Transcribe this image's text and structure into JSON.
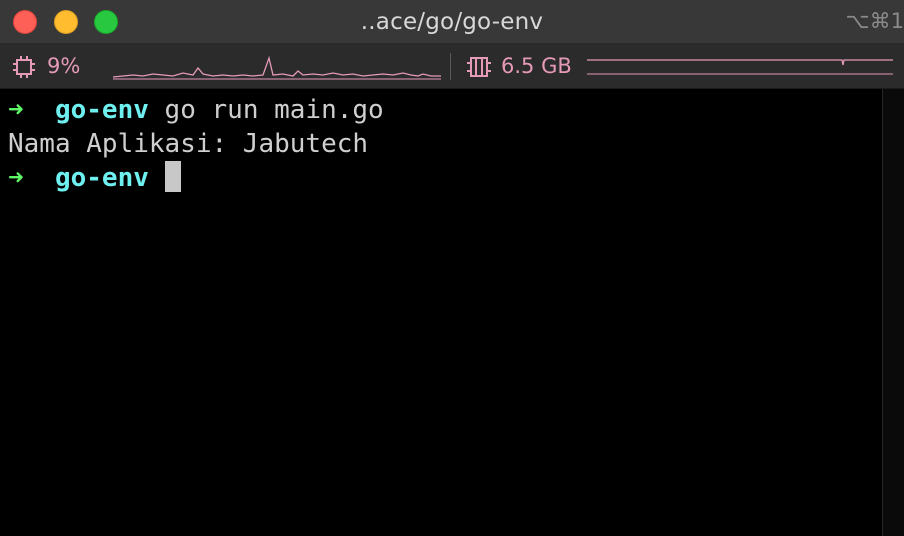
{
  "window": {
    "title": "..ace/go/go-env",
    "shortcut": "⌥⌘1"
  },
  "status": {
    "cpu_value": "9%",
    "mem_value": "6.5 GB",
    "accent_color": "#e59ab8",
    "cpu_icon": "cpu-chip-icon",
    "mem_icon": "memory-icon"
  },
  "terminal": {
    "prompt_symbol": "➜",
    "directory": "go-env",
    "command": "go run main.go",
    "output": "Nama Aplikasi: Jabutech",
    "prompt_color": "#5ff967",
    "dir_color": "#6ff0f0",
    "text_color": "#cfcfcf",
    "cursor_color": "#c8c8c8"
  }
}
